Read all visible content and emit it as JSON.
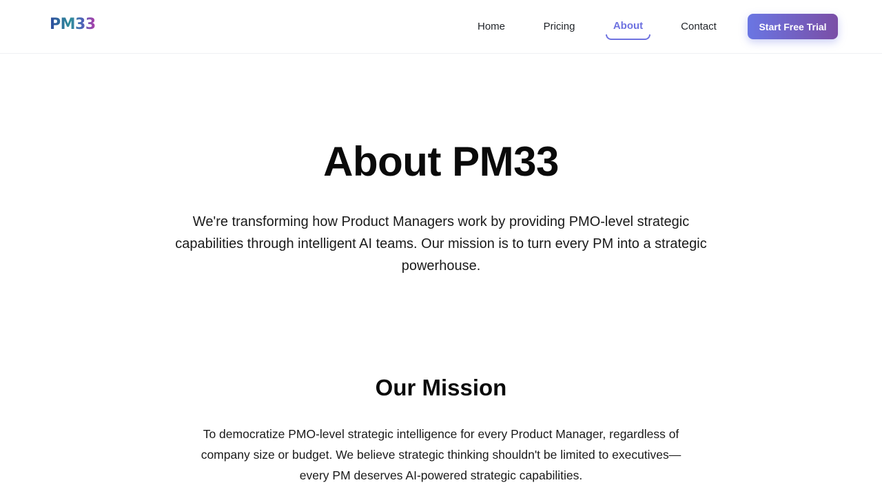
{
  "header": {
    "logo_text": "PM33",
    "nav": [
      {
        "label": "Home"
      },
      {
        "label": "Pricing"
      },
      {
        "label": "About"
      },
      {
        "label": "Contact"
      }
    ],
    "active_nav": "About",
    "cta_label": "Start Free Trial"
  },
  "hero": {
    "title": "About PM33",
    "subtitle": "We're transforming how Product Managers work by providing PMO-level strategic capabilities through intelligent AI teams. Our mission is to turn every PM into a strategic powerhouse."
  },
  "mission": {
    "title": "Our Mission",
    "body": "To democratize PMO-level strategic intelligence for every Product Manager, regardless of company size or budget. We believe strategic thinking shouldn't be limited to executives—every PM deserves AI-powered strategic capabilities."
  },
  "colors": {
    "accent": "#6e72e0",
    "cta_gradient_start": "#6a76e3",
    "cta_gradient_end": "#7a4ea6"
  }
}
